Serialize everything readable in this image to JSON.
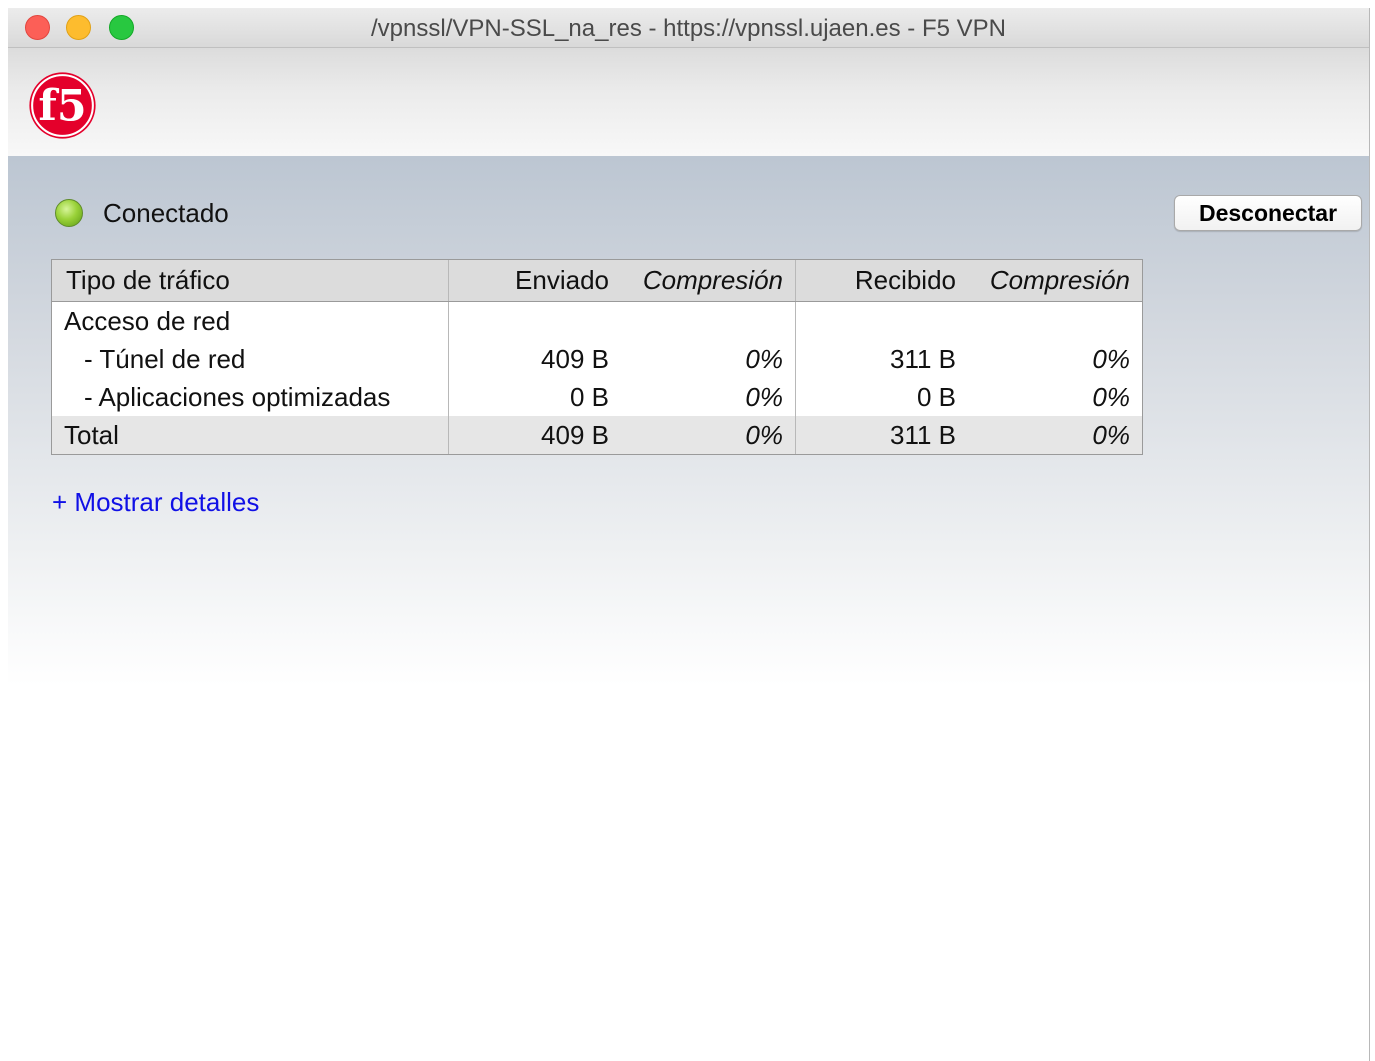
{
  "window": {
    "title": "/vpnssl/VPN-SSL_na_res - https://vpnssl.ujaen.es - F5 VPN"
  },
  "logo": {
    "icon": "f5-logo-icon",
    "brand_color": "#e4002b"
  },
  "status": {
    "label": "Conectado",
    "indicator_color": "#8cc63f"
  },
  "disconnect_button": {
    "label": "Desconectar"
  },
  "table": {
    "headers": {
      "type": "Tipo de tráfico",
      "sent": "Enviado",
      "sent_compression": "Compresión",
      "received": "Recibido",
      "received_compression": "Compresión"
    },
    "rows": [
      {
        "type": "Acceso de red",
        "sent": "",
        "sent_compression": "",
        "received": "",
        "received_compression": ""
      },
      {
        "type": "- Túnel de red",
        "sent": "409 B",
        "sent_compression": "0%",
        "received": "311 B",
        "received_compression": "0%"
      },
      {
        "type": "- Aplicaciones optimizadas",
        "sent": "0 B",
        "sent_compression": "0%",
        "received": "0 B",
        "received_compression": "0%"
      }
    ],
    "total": {
      "type": "Total",
      "sent": "409 B",
      "sent_compression": "0%",
      "received": "311 B",
      "received_compression": "0%"
    }
  },
  "details_link": {
    "label": "+ Mostrar detalles",
    "color": "#1010e6"
  }
}
